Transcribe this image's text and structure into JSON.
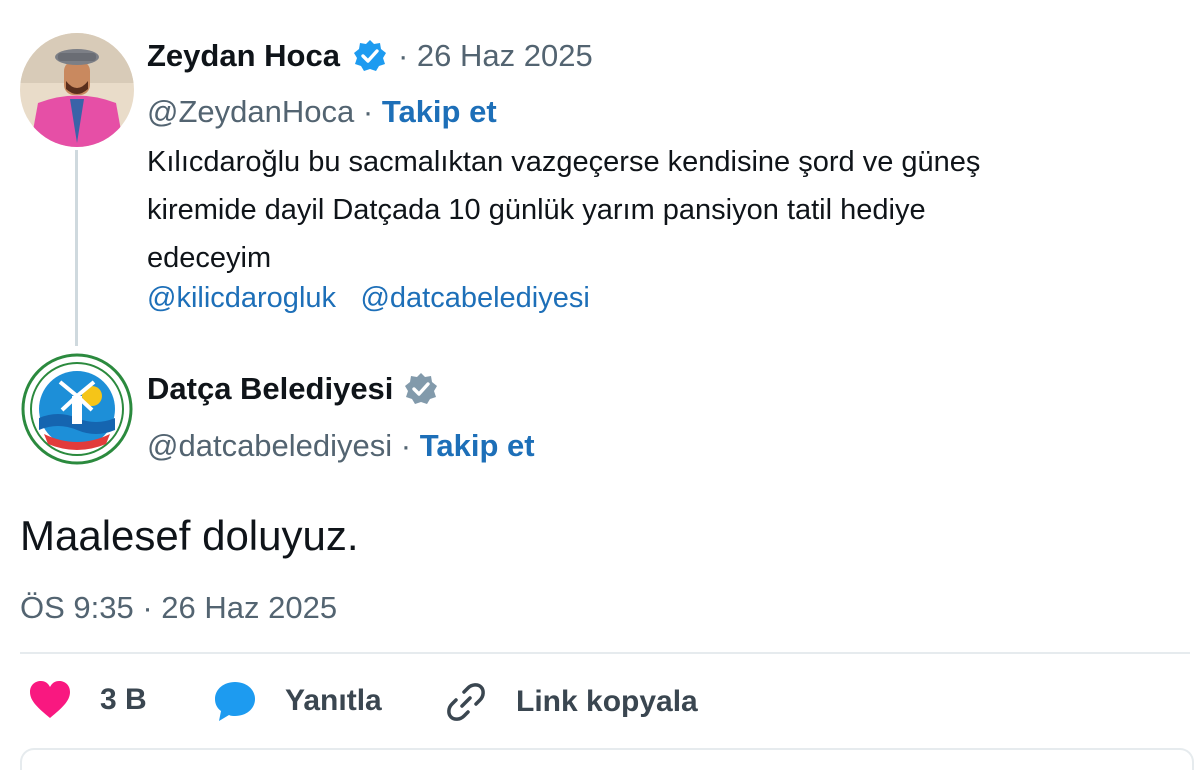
{
  "tweet": {
    "author_name": "Zeydan Hoca",
    "date": "· 26 Haz 2025",
    "handle": "@ZeydanHoca ·",
    "follow_label": "Takip et",
    "text_line1": "Kılıcdaroğlu bu sacmalıktan  vazgeçerse  kendisine şord ve güneş",
    "text_line2": "kiremide dayil Datçada  10 günlük yarım pansiyon tatil hediye",
    "text_line3": "edeceyim",
    "mentions": [
      "@kilicdarogluk",
      "@datcabelediyesi"
    ]
  },
  "reply": {
    "author_name": "Datça Belediyesi",
    "handle": "@datcabelediyesi ·",
    "follow_label": "Takip et",
    "text": "Maalesef doluyuz.",
    "timestamp": "ÖS 9:35 · 26 Haz 2025"
  },
  "actions": {
    "like_count": "3 B",
    "reply_label": "Yanıtla",
    "copy_link_label": "Link kopyala"
  },
  "colors": {
    "link": "#1d6fb8",
    "like": "#f91880",
    "reply_icon": "#1d9bf0",
    "verified_blue": "#1d9bf0",
    "verified_gray": "#829aab"
  },
  "icons": [
    "heart-icon",
    "speech-bubble-icon",
    "link-icon",
    "verified-badge-icon"
  ]
}
